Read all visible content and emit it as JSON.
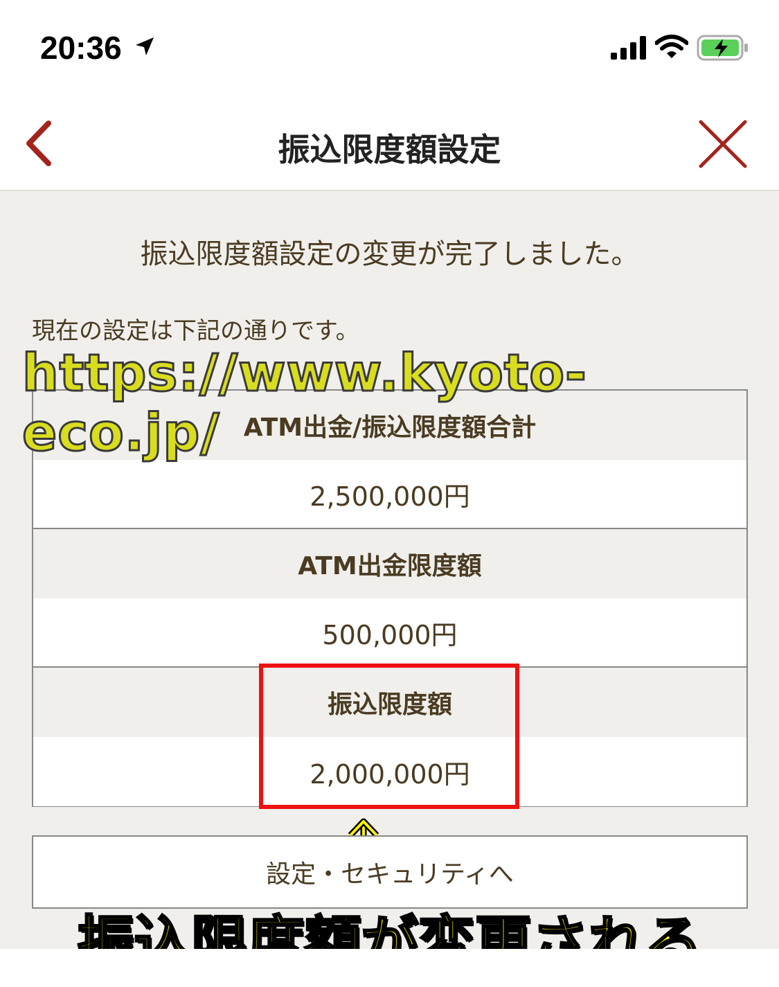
{
  "status_bar": {
    "time": "20:36",
    "icons": [
      "location-arrow-icon",
      "cellular-signal-icon",
      "wifi-icon",
      "battery-charging-icon"
    ],
    "battery_color": "#5ad05a"
  },
  "nav": {
    "title": "振込限度額設定",
    "accent_color": "#a3241d"
  },
  "content": {
    "completion_message": "振込限度額設定の変更が完了しました。",
    "current_settings_note": "現在の設定は下記の通りです。",
    "watermark_url": "https://www.kyoto-eco.jp/",
    "limits": [
      {
        "label": "ATM出金/振込限度額合計",
        "value": "2,500,000円"
      },
      {
        "label": "ATM出金限度額",
        "value": "500,000円"
      },
      {
        "label": "振込限度額",
        "value": "2,000,000円"
      }
    ],
    "security_button_label": "設定・セキュリティへ",
    "caption": "振込限度額が変更される",
    "highlight_color": "#ee1111"
  }
}
